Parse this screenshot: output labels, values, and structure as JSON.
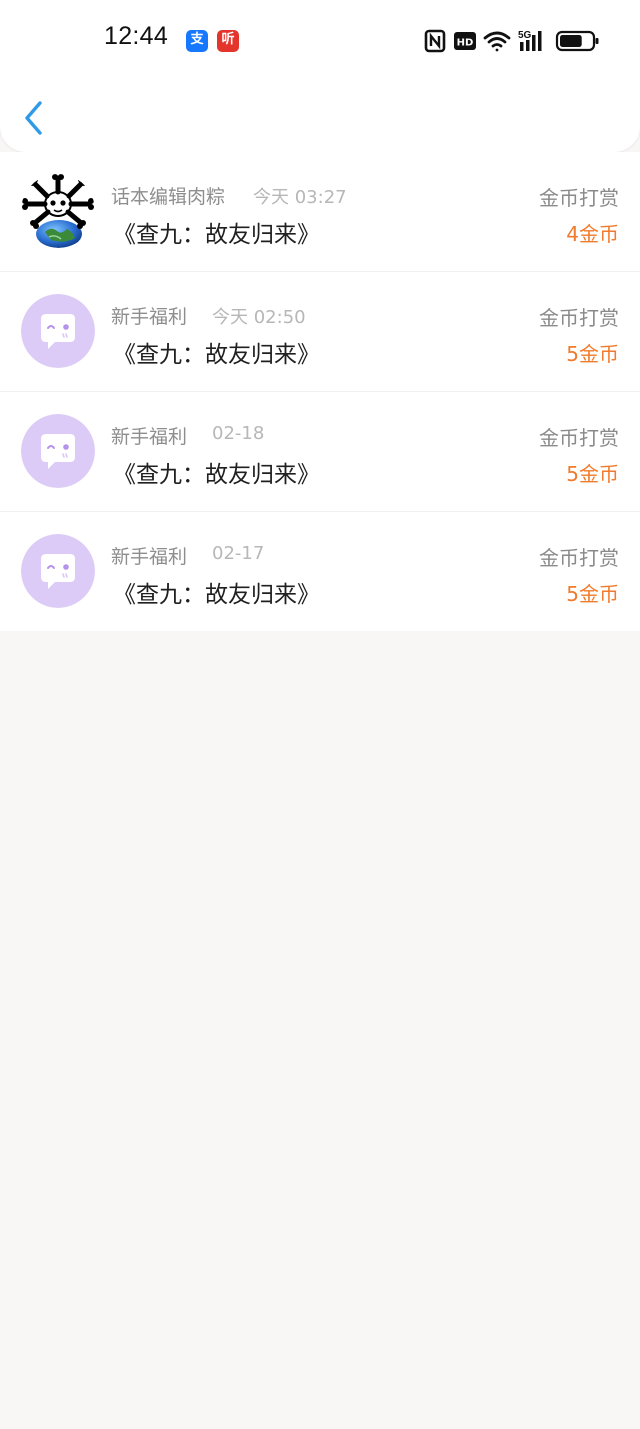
{
  "status_bar": {
    "time": "12:44",
    "apps": [
      "支",
      "听"
    ],
    "icons": [
      "nfc-icon",
      "hd-icon",
      "wifi-icon",
      "5g-signal-icon",
      "battery-icon"
    ],
    "network": "5G",
    "hd_label": "HD",
    "battery_level": 0.7
  },
  "nav": {
    "back_icon": "chevron-left-icon",
    "accent_color": "#2f9be6"
  },
  "records": [
    {
      "sender": "话本编辑肉粽",
      "time": "今天 03:27",
      "title": "《查九：故友归来》",
      "reward_type": "金币打赏",
      "amount": "4金币",
      "avatar": "skull-earth-avatar"
    },
    {
      "sender": "新手福利",
      "time": "今天 02:50",
      "title": "《查九：故友归来》",
      "reward_type": "金币打赏",
      "amount": "5金币",
      "avatar": "chat-bubble-avatar"
    },
    {
      "sender": "新手福利",
      "time": "02-18",
      "title": "《查九：故友归来》",
      "reward_type": "金币打赏",
      "amount": "5金币",
      "avatar": "chat-bubble-avatar"
    },
    {
      "sender": "新手福利",
      "time": "02-17",
      "title": "《查九：故友归来》",
      "reward_type": "金币打赏",
      "amount": "5金币",
      "avatar": "chat-bubble-avatar"
    }
  ],
  "colors": {
    "amount": "#f07b2c",
    "avatar_bg": "#dccbf6",
    "background": "#f9f6f6"
  }
}
